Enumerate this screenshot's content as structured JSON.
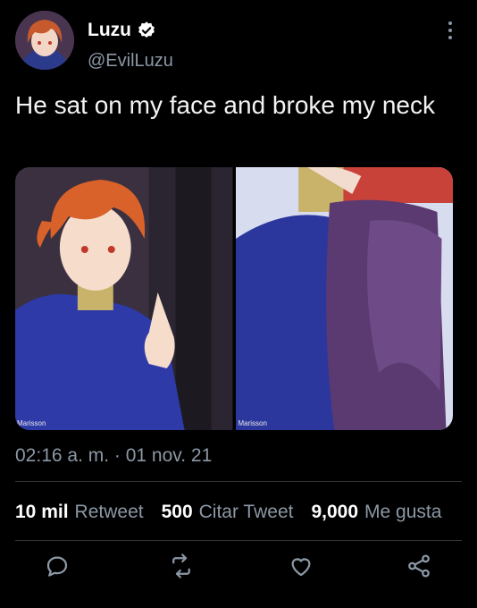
{
  "user": {
    "display_name": "Luzu",
    "handle": "@EvilLuzu",
    "verified": true
  },
  "tweet": {
    "text": "He sat on my face and broke my neck",
    "timestamp": "02:16 a. m. · 01 nov. 21"
  },
  "media": [
    {
      "watermark": "Marisson"
    },
    {
      "watermark": "Marisson"
    }
  ],
  "stats": {
    "retweets_count": "10 mil",
    "retweets_label": "Retweet",
    "quotes_count": "500",
    "quotes_label": "Citar Tweet",
    "likes_count": "9,000",
    "likes_label": "Me gusta"
  },
  "actions": [
    "reply-icon",
    "retweet-icon",
    "like-icon",
    "share-icon"
  ],
  "colors": {
    "background": "#000000",
    "muted": "#8b98a5",
    "verified": "#ffffff"
  }
}
